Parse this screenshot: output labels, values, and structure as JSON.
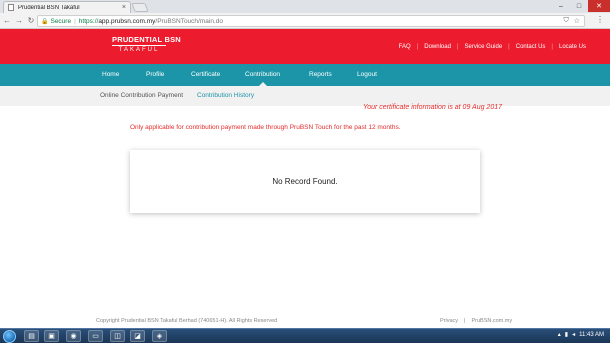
{
  "browser": {
    "tab_title": "Prudential BSN Takaful",
    "tab_close": "×",
    "secure_label": "Secure",
    "url_scheme": "https://",
    "url_host": "app.prubsn.com.my",
    "url_path": "/PruBSNTouch/main.do",
    "window_controls": [
      "–",
      "□",
      "✕"
    ]
  },
  "header": {
    "logo_line1": "PRUDENTIAL BSN",
    "logo_line2": "TAKAFUL",
    "links": [
      "FAQ",
      "Download",
      "Service Guide",
      "Contact Us",
      "Locate Us"
    ]
  },
  "mainnav": {
    "items": [
      "Home",
      "Profile",
      "Certificate",
      "Contribution",
      "Reports",
      "Logout"
    ],
    "active": "Contribution"
  },
  "subnav": {
    "items": [
      "Online Contribution Payment",
      "Contribution History"
    ],
    "active": "Contribution History"
  },
  "main": {
    "cert_info": "Your certificate information is at 09 Aug 2017",
    "note": "Only applicable for contribution payment made through PruBSN Touch for the past 12 months.",
    "empty_message": "No Record Found."
  },
  "footer": {
    "copyright": "Copyright Prudential BSN Takaful Berhad (740651-H). All Rights Reserved",
    "links": [
      "Privacy",
      "|",
      "PruBSN.com.my"
    ]
  },
  "taskbar": {
    "clock": "11:43 AM"
  },
  "colors": {
    "brand_red": "#ed1b2e",
    "nav_teal": "#1b95a7",
    "subnav_active": "#1b95a7",
    "alert_red": "#e42c2c"
  }
}
